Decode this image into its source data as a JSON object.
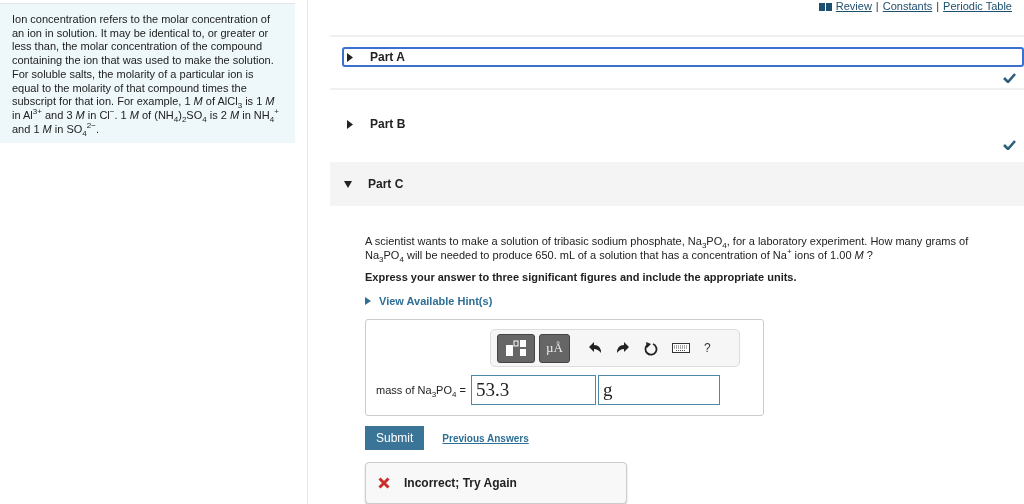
{
  "intro": "Ion concentration refers to the molar concentration of an ion in solution. It may be identical to, or greater or less than, the molar concentration of the compound containing the ion that was used to make the solution. For soluble salts, the molarity of a particular ion is equal to the molarity of that compound times the subscript for that ion. For example, 1 *M* of AlCl$_{3}$ is 1 *M* in Al$^{3+}$ and 3 *M* in Cl$^{−}$. 1 *M* of (NH$_{4}$)$_{2}$SO$_{4}$ is 2 *M* in NH$_{4}$$^{+}$ and 1 *M* in SO$_{4}$$^{2−}$.",
  "top_links": [
    "Review",
    "Constants",
    "Periodic Table"
  ],
  "top_separator": "|",
  "parts": [
    {
      "label": "Part A",
      "expanded": false,
      "completed": true,
      "focused": true
    },
    {
      "label": "Part B",
      "expanded": false,
      "completed": true,
      "focused": false
    },
    {
      "label": "Part C",
      "expanded": true,
      "completed": false,
      "focused": false
    }
  ],
  "question": "A scientist wants to make a solution of tribasic sodium phosphate, Na$_{3}$PO$_{4}$, for a laboratory experiment. How many grams of Na$_{3}$PO$_{4}$ will be needed to produce 650. mL of a solution that has a concentration of Na$^{+}$ ions of 1.00 *M* ?",
  "instruction": "Express your answer to three significant figures and include the appropriate units.",
  "hints_link": "View Available Hint(s)",
  "toolbar": {
    "units_button": "µÅ",
    "help": "?"
  },
  "answer": {
    "label": "mass of Na$_{3}$PO$_{4}$ =",
    "value": "53.3",
    "unit": "g"
  },
  "submit": "Submit",
  "previous_answers": "Previous Answers",
  "feedback": {
    "correct": false,
    "text": "Incorrect; Try Again"
  }
}
